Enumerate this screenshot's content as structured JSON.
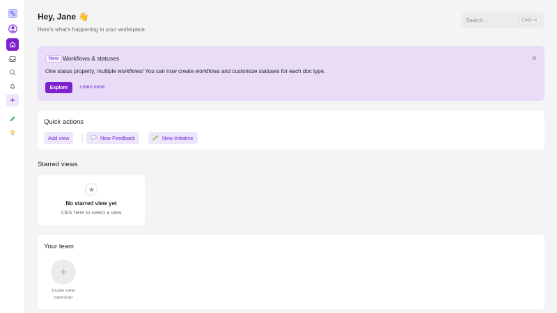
{
  "header": {
    "greeting": "Hey, Jane 👋",
    "subtitle": "Here's what's happening in your workspace"
  },
  "search": {
    "placeholder": "Search...",
    "shortcut": "CMD+K"
  },
  "sidebar": {
    "items": [
      {
        "icon": "workspace-logo-icon"
      },
      {
        "icon": "user-avatar-icon"
      },
      {
        "icon": "home-icon",
        "active": true
      },
      {
        "icon": "inbox-icon"
      },
      {
        "icon": "search-icon"
      },
      {
        "icon": "bell-icon"
      },
      {
        "icon": "plus-icon"
      },
      {
        "icon": "pencil-icon"
      },
      {
        "icon": "lightbulb-icon"
      }
    ]
  },
  "banner": {
    "badge": "New",
    "title": "Workflows & statuses",
    "description": "One status property, multiple workflows! You can now create workflows and customize statuses for each doc type.",
    "primary_button": "Explore",
    "secondary_link": "Learn more"
  },
  "quick_actions": {
    "title": "Quick actions",
    "actions": [
      {
        "label": "Add view",
        "icon": ""
      },
      {
        "label": "New Feedback",
        "icon": "speech-bubble-icon"
      },
      {
        "label": "New Initiative",
        "icon": "sprout-icon"
      }
    ]
  },
  "starred": {
    "title": "Starred views",
    "empty_title": "No starred view yet",
    "empty_hint": "Click here to select a view"
  },
  "team": {
    "title": "Your team",
    "invite_label": "Invite new member"
  },
  "colors": {
    "accent": "#7e22ce",
    "accent_text": "#6d28d9",
    "banner_bg": "#e9dcf7",
    "chip_bg": "#eee6fb",
    "page_bg": "#f4f4f5"
  }
}
